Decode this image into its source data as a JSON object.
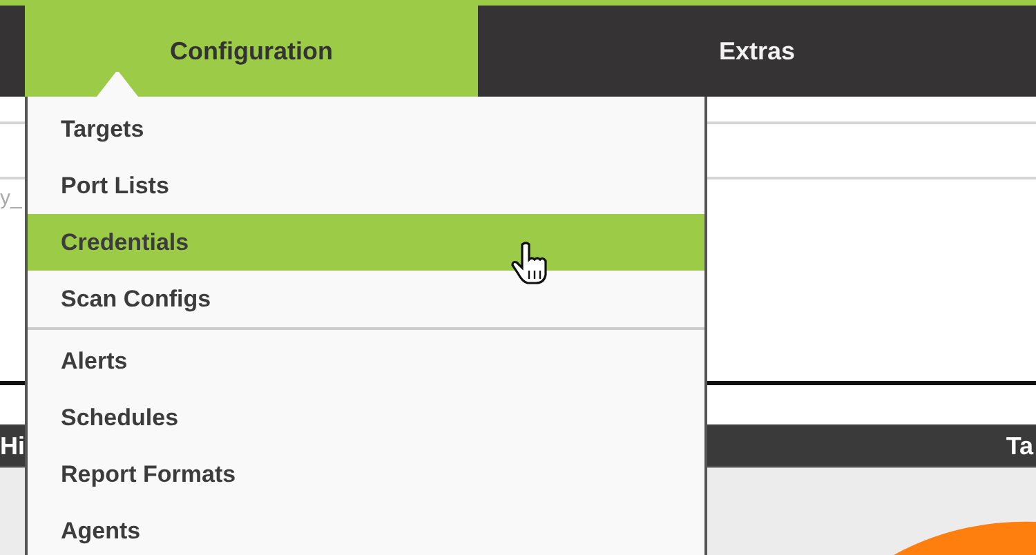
{
  "nav": {
    "tabs": [
      {
        "label": "Configuration",
        "selected": true
      },
      {
        "label": "Extras",
        "selected": false
      }
    ]
  },
  "menu": {
    "groups": [
      [
        {
          "label": "Targets",
          "selected": false
        },
        {
          "label": "Port Lists",
          "selected": false
        },
        {
          "label": "Credentials",
          "selected": true
        },
        {
          "label": "Scan Configs",
          "selected": false
        }
      ],
      [
        {
          "label": "Alerts",
          "selected": false
        },
        {
          "label": "Schedules",
          "selected": false
        },
        {
          "label": "Report Formats",
          "selected": false
        },
        {
          "label": "Agents",
          "selected": false
        }
      ]
    ]
  },
  "background": {
    "cut_text": "y_",
    "left_header": "Hi",
    "right_header": "Ta"
  }
}
